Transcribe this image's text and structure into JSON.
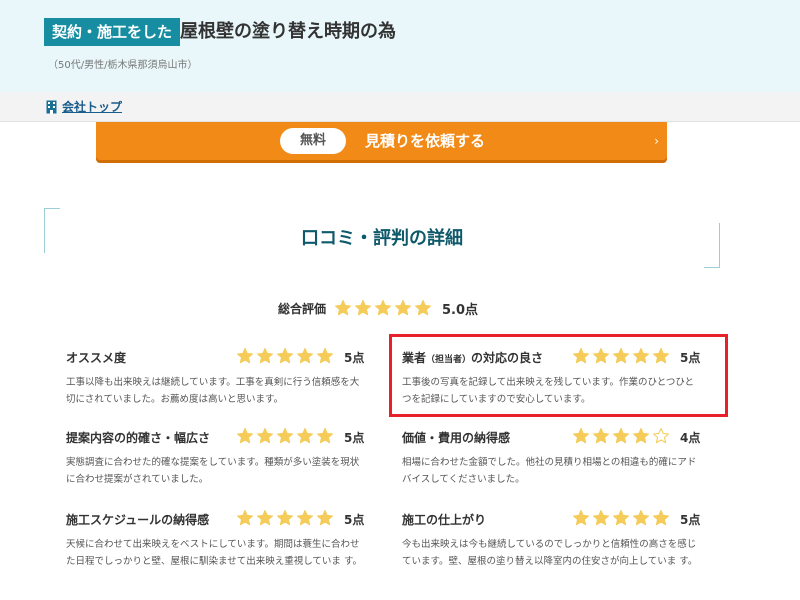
{
  "header": {
    "badge": "契約・施工をした",
    "title": "屋根壁の塗り替え時期の為",
    "subinfo": "（50代/男性/栃木県那須烏山市）"
  },
  "nav": {
    "company_top": "会社トップ"
  },
  "cta": {
    "free_label": "無料",
    "text": "見積りを依頼する",
    "arrow": "›"
  },
  "section": {
    "title": "口コミ・評判の詳細"
  },
  "overall": {
    "label": "総合評価",
    "rating": 5,
    "score": "5.0点"
  },
  "items": [
    {
      "title": "オススメ度",
      "rating": 5,
      "score": "5点",
      "comment": "工事以降も出来映えは継続しています。工事を真剣に行う信頼感を大切にされていました。お薦め度は高いと思います。"
    },
    {
      "title": "業者",
      "title_small": "（担当者）",
      "title_rest": "の対応の良さ",
      "rating": 5,
      "score": "5点",
      "comment": "工事後の写真を記録して出来映えを残しています。作業のひとつひとつを記録にしていますので安心しています。"
    },
    {
      "title": "提案内容の的確さ・幅広さ",
      "rating": 5,
      "score": "5点",
      "comment": "実態調査に合わせた的確な提案をしています。種類が多い塗装を現状に合わせ提案がされていました。"
    },
    {
      "title": "価値・費用の納得感",
      "rating": 4,
      "score": "4点",
      "comment": "相場に合わせた金額でした。他社の見積り相場との相違も的確にアドバイスしてくださいました。"
    },
    {
      "title": "施工スケジュールの納得感",
      "rating": 5,
      "score": "5点",
      "comment": "天候に合わせて出来映えをベストにしています。期間は蓑生に合わせた日程でしっかりと壁、屋根に馴染ませて出来映え重視していま す。"
    },
    {
      "title": "施工の仕上がり",
      "rating": 5,
      "score": "5点",
      "comment": "今も出来映えは今も継続しているのでしっかりと信頼性の高さを感じています。壁、屋根の塗り替え以降室内の住安さが向上していま す。"
    }
  ],
  "colors": {
    "accent": "#168da0",
    "cta": "#f28a18",
    "star_filled": "#f5cc5a",
    "star_empty": "#ffffff",
    "highlight": "#e8202a"
  }
}
